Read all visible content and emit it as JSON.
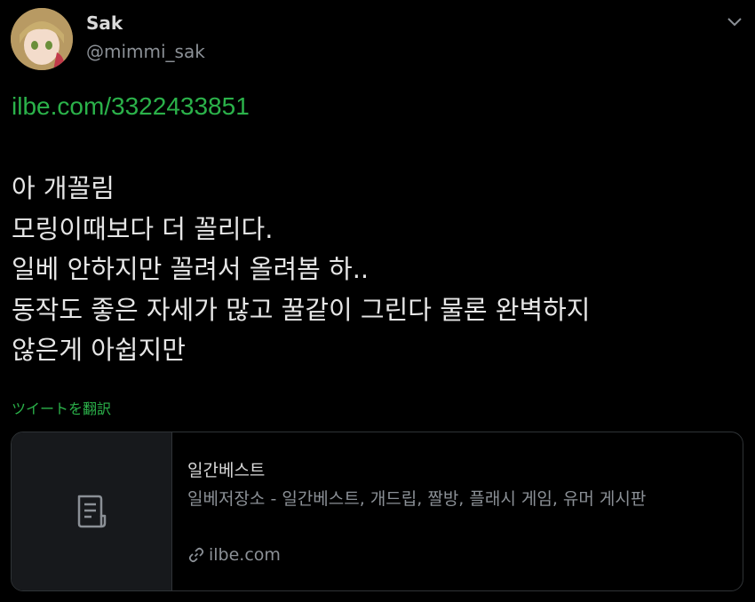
{
  "author": {
    "display_name": "Sak",
    "handle": "@mimmi_sak"
  },
  "tweet": {
    "link": "ilbe.com/3322433851",
    "lines": [
      "아 개꼴림",
      "모링이때보다 더 꼴리다.",
      "일베 안하지만 꼴려서 올려봄 하..",
      "동작도 좋은 자세가 많고 꿀같이 그린다 물론 완벽하지",
      "않은게 아쉽지만"
    ],
    "translate_label": "ツイートを翻訳"
  },
  "card": {
    "title": "일간베스트",
    "description": "일베저장소 - 일간베스트, 개드립, 짤방, 플래시 게임, 유머 게시판",
    "domain": "ilbe.com"
  },
  "icons": {
    "caret": "chevron-down-icon",
    "card_thumb": "document-icon",
    "domain": "link-icon"
  },
  "colors": {
    "background": "#000000",
    "accent_green": "#2bb24a",
    "secondary_text": "#8b9096",
    "border": "#2f3336"
  }
}
